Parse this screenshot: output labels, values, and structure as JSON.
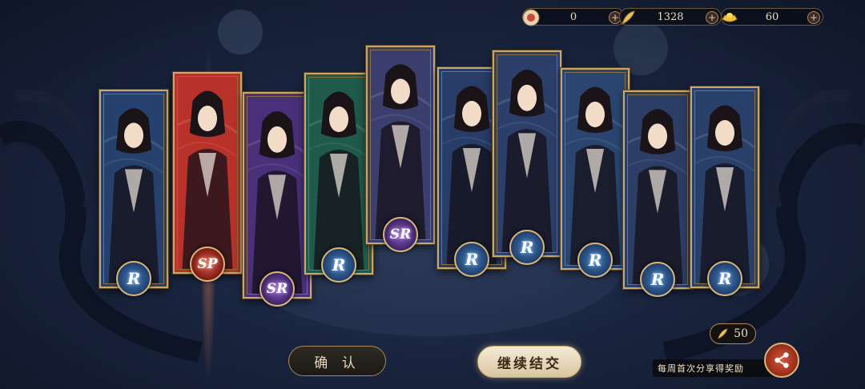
{
  "currency": {
    "items": [
      {
        "icon": "summon-token-icon",
        "value": "0"
      },
      {
        "icon": "feather-icon",
        "value": "1328"
      },
      {
        "icon": "gold-ingot-icon",
        "value": "60"
      }
    ]
  },
  "cards": [
    {
      "rarity": "R",
      "frame": "#26416e"
    },
    {
      "rarity": "SP",
      "frame": "#b8322a"
    },
    {
      "rarity": "SR",
      "frame": "#4a2f7a"
    },
    {
      "rarity": "R",
      "frame": "#1f5a4a"
    },
    {
      "rarity": "SR",
      "frame": "#3b3f6e"
    },
    {
      "rarity": "R",
      "frame": "#273c66"
    },
    {
      "rarity": "R",
      "frame": "#2c3f6a"
    },
    {
      "rarity": "R",
      "frame": "#2a4670"
    },
    {
      "rarity": "R",
      "frame": "#2c3d66"
    },
    {
      "rarity": "R",
      "frame": "#29406b"
    }
  ],
  "buttons": {
    "confirm": "确 认",
    "continue": "继续结交"
  },
  "share": {
    "reward": "50",
    "label": "每周首次分享得奖励"
  },
  "colors": {
    "gold": "#c9a86a",
    "r_badge": "#2f5a94",
    "sr_badge": "#5a3a90",
    "sp_badge": "#b83a2a"
  }
}
